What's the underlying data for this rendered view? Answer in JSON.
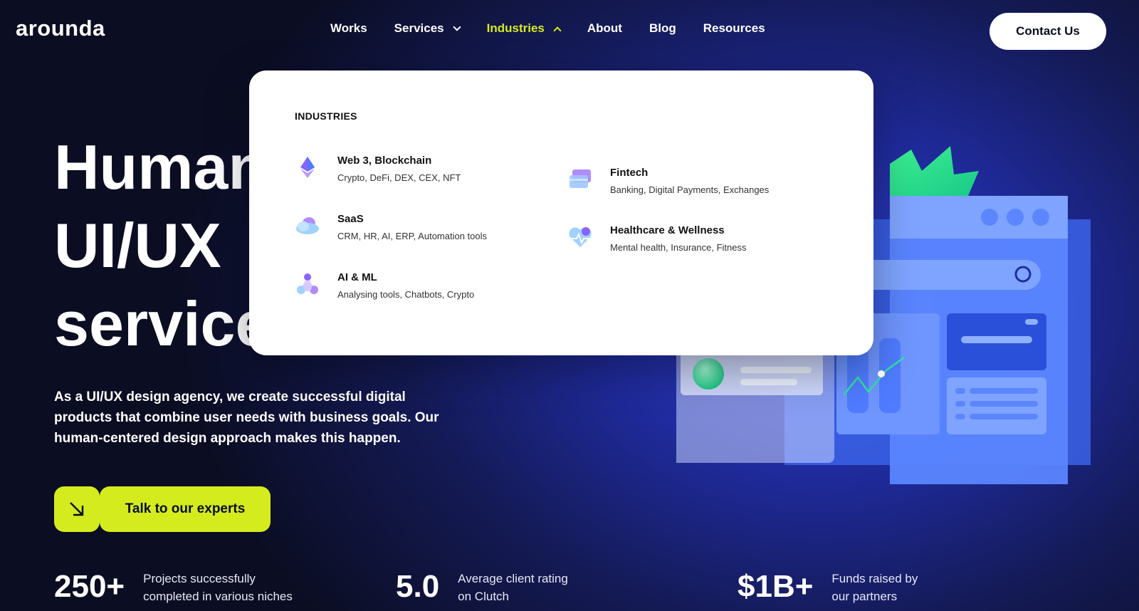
{
  "header": {
    "logo": "arounda",
    "nav": [
      {
        "label": "Works"
      },
      {
        "label": "Services"
      },
      {
        "label": "Industries"
      },
      {
        "label": "About"
      },
      {
        "label": "Blog"
      },
      {
        "label": "Resources"
      }
    ],
    "contact_label": "Contact Us"
  },
  "hero": {
    "title_line1": "Human",
    "title_line2": "UI/UX",
    "title_line3": "service",
    "description": "As a UI/UX design agency, we create successful digital products that combine user needs with business goals. Our human-centered design approach makes this happen.",
    "cta_label": "Talk to our experts"
  },
  "stats": [
    {
      "value": "250+",
      "label": "Projects successfully completed in various niches"
    },
    {
      "value": "5.0",
      "label": "Average client rating on Clutch"
    },
    {
      "value": "$1B+",
      "label": "Funds raised by our partners"
    }
  ],
  "dropdown": {
    "heading": "INDUSTRIES",
    "items": [
      {
        "title": "Web 3, Blockchain",
        "subtitle": "Crypto, DeFi, DEX, CEX, NFT",
        "icon": "ethereum-icon"
      },
      {
        "title": "SaaS",
        "subtitle": "CRM, HR, AI, ERP, Automation tools",
        "icon": "cloud-icon"
      },
      {
        "title": "AI & ML",
        "subtitle": "Analysing tools, Chatbots, Crypto",
        "icon": "network-icon"
      },
      {
        "title": "Fintech",
        "subtitle": "Banking, Digital Payments, Exchanges",
        "icon": "card-icon"
      },
      {
        "title": "Healthcare & Wellness",
        "subtitle": "Mental health, Insurance, Fitness",
        "icon": "heart-icon"
      }
    ]
  },
  "colors": {
    "accent": "#d4ec1e",
    "background": "#0b0d22",
    "illustration_blue": "#4f7bff",
    "illustration_green": "#2ee59d"
  }
}
